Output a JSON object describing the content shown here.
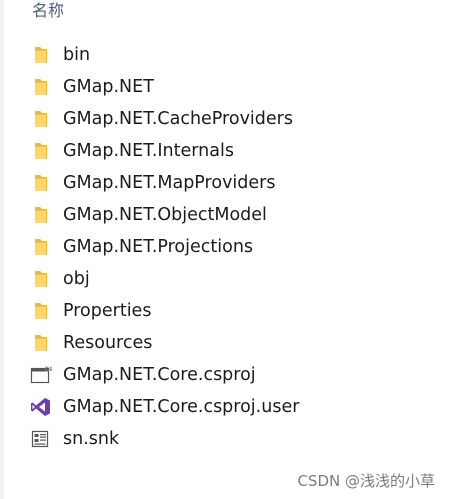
{
  "header": {
    "label": "名称"
  },
  "items": [
    {
      "label": "bin",
      "icon": "folder-icon"
    },
    {
      "label": "GMap.NET",
      "icon": "folder-icon"
    },
    {
      "label": "GMap.NET.CacheProviders",
      "icon": "folder-icon"
    },
    {
      "label": "GMap.NET.Internals",
      "icon": "folder-icon"
    },
    {
      "label": "GMap.NET.MapProviders",
      "icon": "folder-icon"
    },
    {
      "label": "GMap.NET.ObjectModel",
      "icon": "folder-icon"
    },
    {
      "label": "GMap.NET.Projections",
      "icon": "folder-icon"
    },
    {
      "label": "obj",
      "icon": "folder-icon"
    },
    {
      "label": "Properties",
      "icon": "folder-icon"
    },
    {
      "label": "Resources",
      "icon": "folder-icon"
    },
    {
      "label": "GMap.NET.Core.csproj",
      "icon": "csproj-file-icon"
    },
    {
      "label": "GMap.NET.Core.csproj.user",
      "icon": "visual-studio-icon"
    },
    {
      "label": "sn.snk",
      "icon": "key-file-icon"
    }
  ],
  "watermark": {
    "text": "CSDN @浅浅的小草"
  },
  "colors": {
    "folder_back": "#e9b73a",
    "folder_front": "#ffd667",
    "vs_purple": "#6c3fb5",
    "csproj_green": "#3f9b5b",
    "header_text": "#4c607a",
    "item_text": "#1b1b1b"
  }
}
